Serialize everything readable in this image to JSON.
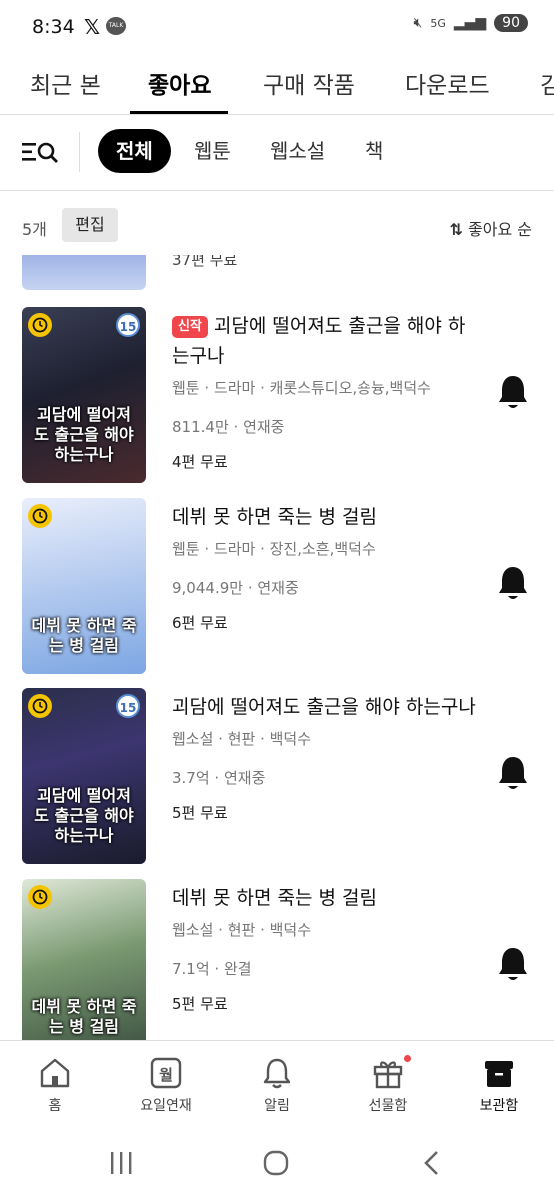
{
  "status_bar": {
    "time": "8:34",
    "x_glyph": "𝕏",
    "talk_badge": "TALK",
    "network": "5G",
    "battery": "90"
  },
  "tabs": [
    {
      "label": "최근 본"
    },
    {
      "label": "좋아요"
    },
    {
      "label": "구매 작품"
    },
    {
      "label": "다운로드"
    },
    {
      "label": "김"
    }
  ],
  "filters": {
    "icon": "filter-search-icon",
    "chips": [
      "전체",
      "웹툰",
      "웹소설",
      "책"
    ]
  },
  "toolbar": {
    "count": "5개",
    "edit": "편집",
    "sort": "좋아요 순"
  },
  "partial_item": {
    "text": "37편 무료"
  },
  "items": [
    {
      "new_badge": "신작",
      "title": "괴담에 떨어져도 출근을 해야 하는구나",
      "meta": "웹툰 · 드라마 · 캐롯스튜디오,숑늉,백덕수",
      "views": "811.4만",
      "status": "연재중",
      "free": "4편 무료",
      "age": "15",
      "cover_title": "괴담에 떨어져도 출근을 해야 하는구나"
    },
    {
      "title": "데뷔 못 하면 죽는 병 걸림",
      "meta": "웹툰 · 드라마 · 장진,소흔,백덕수",
      "views": "9,044.9만",
      "status": "연재중",
      "free": "6편 무료",
      "cover_title": "데뷔 못 하면 죽는 병 걸림"
    },
    {
      "title": "괴담에 떨어져도 출근을 해야 하는구나",
      "meta": "웹소설 · 현판 · 백덕수",
      "views": "3.7억",
      "status": "연재중",
      "free": "5편 무료",
      "age": "15",
      "cover_title": "괴담에 떨어져도 출근을 해야 하는구나"
    },
    {
      "title": "데뷔 못 하면 죽는 병 걸림",
      "meta": "웹소설 · 현판 · 백덕수",
      "views": "7.1억",
      "status": "완결",
      "free": "5편 무료",
      "cover_title": "데뷔 못 하면 죽는 병 걸림"
    }
  ],
  "bottom_nav": [
    {
      "label": "홈",
      "icon": "home-icon"
    },
    {
      "label": "요일연재",
      "icon": "weekday-icon",
      "glyph": "월"
    },
    {
      "label": "알림",
      "icon": "bell-outline-icon"
    },
    {
      "label": "선물함",
      "icon": "gift-icon"
    },
    {
      "label": "보관함",
      "icon": "storage-icon"
    }
  ],
  "colors": {
    "accent": "#000000",
    "new_badge": "#f0454a",
    "clock_badge": "#f5c400"
  }
}
